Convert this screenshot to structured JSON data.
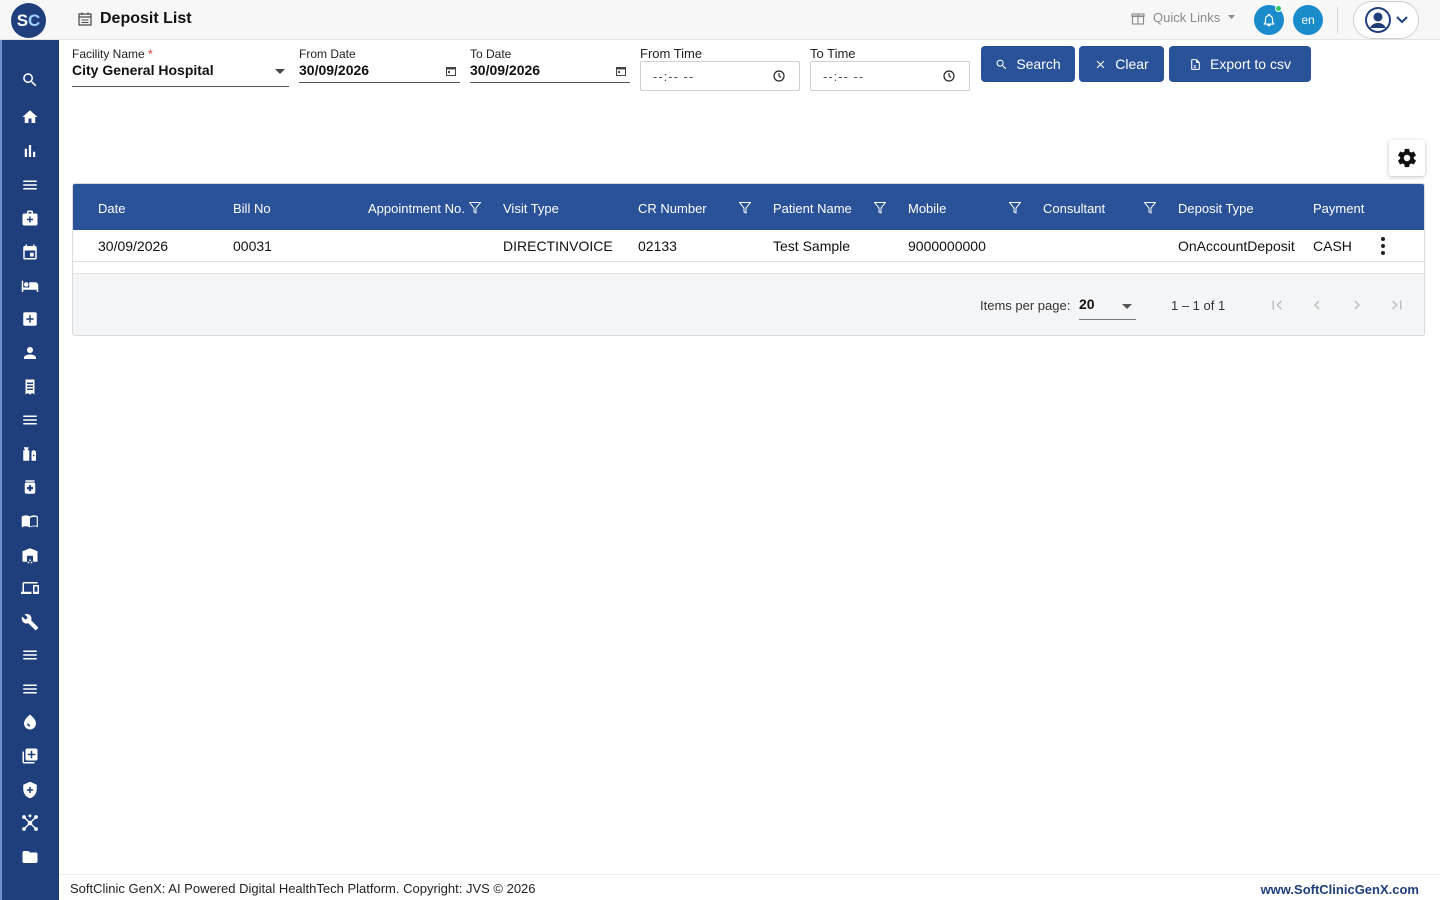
{
  "app": {
    "logo_s": "S",
    "logo_c": "C",
    "page_title": "Deposit List"
  },
  "header": {
    "quick_links_label": "Quick Links",
    "language": "en"
  },
  "filters": {
    "facility_label": "Facility Name",
    "facility_required": "*",
    "facility_value": "City General Hospital",
    "from_date_label": "From Date",
    "from_date_value": "30/09/2026",
    "to_date_label": "To Date",
    "to_date_value": "30/09/2026",
    "from_time_label": "From Time",
    "from_time_placeholder": "--:-- --",
    "to_time_label": "To Time",
    "to_time_placeholder": "--:-- --"
  },
  "actions": {
    "search_label": "Search",
    "clear_label": "Clear",
    "export_label": "Export to csv"
  },
  "table": {
    "columns": [
      "Date",
      "Bill No",
      "Appointment No.",
      "Visit Type",
      "CR Number",
      "Patient Name",
      "Mobile",
      "Consultant",
      "Deposit Type",
      "Payment"
    ],
    "rows": [
      [
        "30/09/2026",
        "00031",
        "",
        "DIRECTINVOICE",
        "02133",
        "Test Sample",
        "9000000000",
        "",
        "OnAccountDeposit",
        "CASH"
      ]
    ]
  },
  "paginator": {
    "items_per_page_label": "Items per page:",
    "items_per_page_value": "20",
    "range_label": "1 – 1 of 1"
  },
  "footer": {
    "copyright": "SoftClinic GenX: AI Powered Digital HealthTech Platform. Copyright: JVS © 2026",
    "website": "www.SoftClinicGenX.com"
  },
  "colors": {
    "primary": "#2a5298",
    "sidebar": "#1f3e7c",
    "accent": "#1a8ccc"
  },
  "sidebar_icons": [
    "search-icon",
    "home-icon",
    "bar-chart-icon",
    "menu-icon",
    "medical-bag-icon",
    "calendar-icon",
    "bed-icon",
    "medical-plus-icon",
    "person-icon",
    "receipt-icon",
    "menu-icon",
    "pharmacy-icon",
    "medication-icon",
    "book-icon",
    "warehouse-icon",
    "devices-icon",
    "wrench-icon",
    "menu-icon",
    "menu-icon",
    "drop-icon",
    "add-box-icon",
    "shield-icon",
    "hub-icon",
    "folder-icon"
  ]
}
